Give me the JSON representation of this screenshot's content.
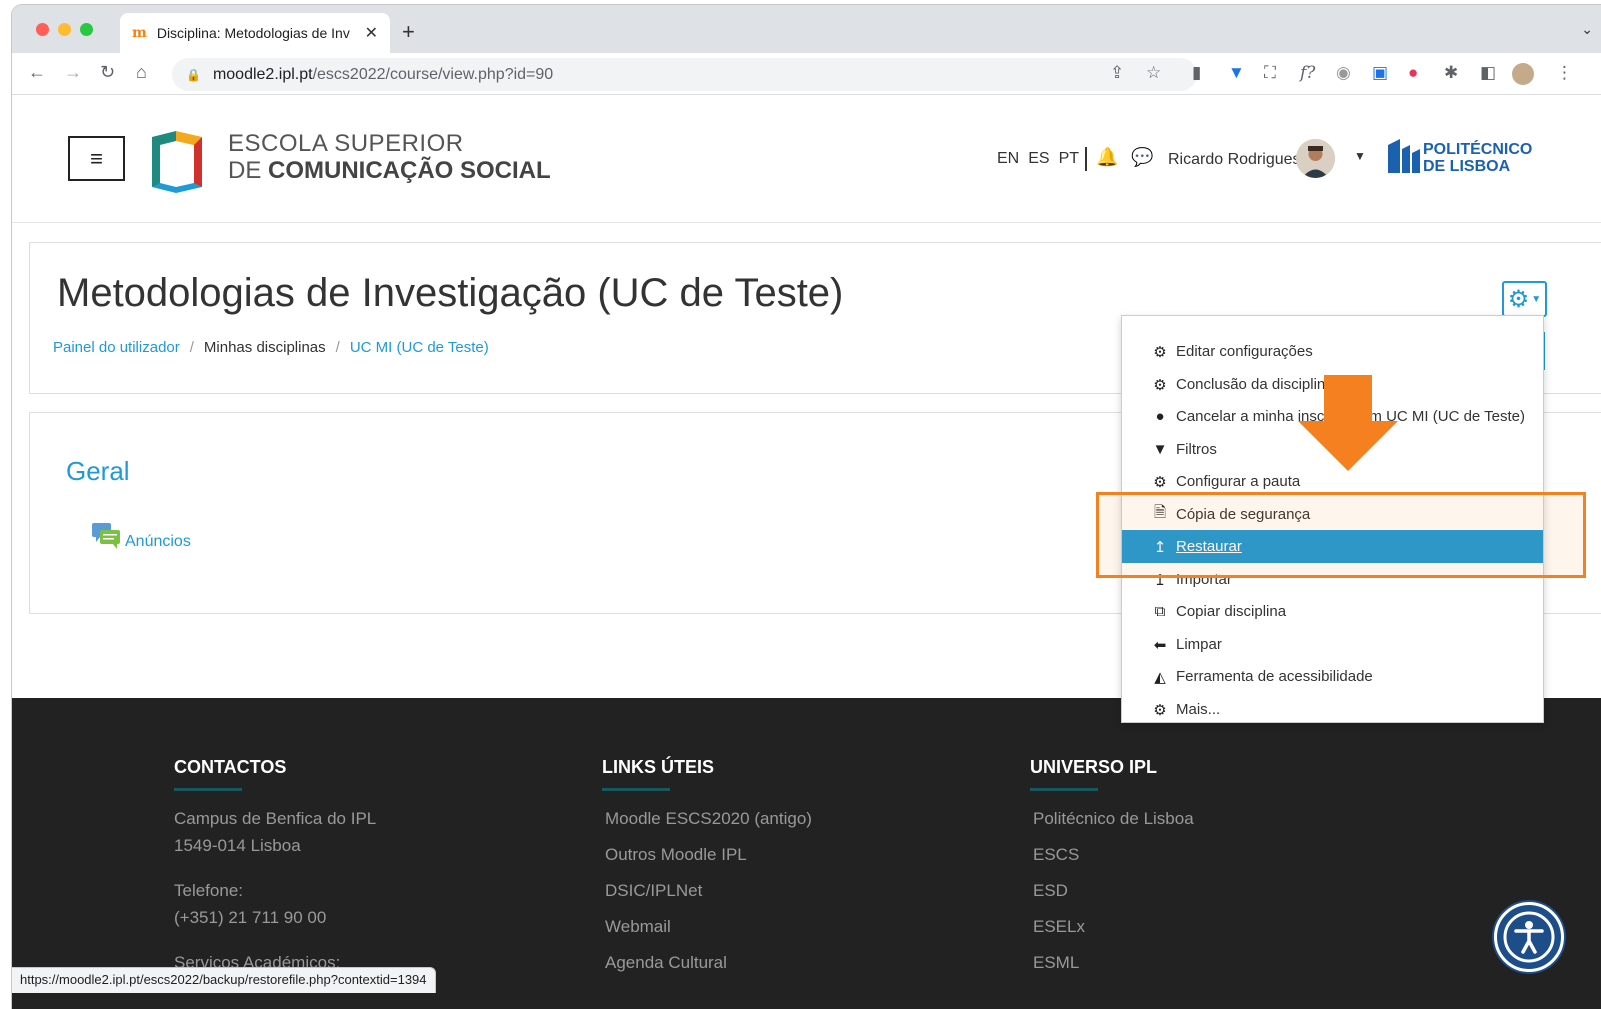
{
  "browser": {
    "tab_title": "Disciplina: Metodologias de Inv",
    "tab_close": "✕",
    "new_tab": "+",
    "url_domain": "moodle2.ipl.pt",
    "url_path": "/escs2022/course/view.php?id=90",
    "status_url": "https://moodle2.ipl.pt/escs2022/backup/restorefile.php?contextid=1394"
  },
  "header": {
    "logo_line1": "ESCOLA SUPERIOR",
    "logo_line2a": "DE ",
    "logo_line2b": "COMUNICAÇÃO SOCIAL",
    "languages": [
      "EN",
      "ES",
      "PT"
    ],
    "user_name": "Ricardo Rodrigues",
    "partner_line1": "POLITÉCNICO",
    "partner_line2": "DE LISBOA"
  },
  "course": {
    "title": "Metodologias de Investigação (UC de Teste)",
    "breadcrumb": [
      "Painel do utilizador",
      "Minhas disciplinas",
      "UC MI (UC de Teste)"
    ],
    "breadcrumb_sep": "/",
    "section_title": "Geral",
    "activity": "Anúncios"
  },
  "menu": {
    "items": [
      {
        "label": "Editar configurações",
        "icon": "gear-icon"
      },
      {
        "label": "Conclusão da disciplina",
        "icon": "gear-icon"
      },
      {
        "label": "Cancelar a minha inscrição em UC MI (UC de Teste)",
        "icon": "user-icon"
      },
      {
        "label": "Filtros",
        "icon": "filter-icon"
      },
      {
        "label": "Configurar a pauta",
        "icon": "gear-icon"
      },
      {
        "label": "Cópia de segurança",
        "icon": "file-icon"
      },
      {
        "label": "Restaurar",
        "icon": "upload-icon"
      },
      {
        "label": "Importar",
        "icon": "upload-icon"
      },
      {
        "label": "Copiar disciplina",
        "icon": "copy-icon"
      },
      {
        "label": "Limpar",
        "icon": "arrow-left-icon"
      },
      {
        "label": "Ferramenta de acessibilidade",
        "icon": "chart-icon"
      },
      {
        "label": "Mais...",
        "icon": "gear-icon"
      }
    ],
    "active_index": 6
  },
  "footer": {
    "contacts_title": "CONTACTOS",
    "contacts": [
      "Campus de Benfica do IPL",
      "1549-014 Lisboa",
      "Telefone:",
      "(+351) 21 711 90 00",
      "Serviços Académicos:"
    ],
    "links_title": "LINKS ÚTEIS",
    "links": [
      "Moodle ESCS2020 (antigo)",
      "Outros Moodle IPL",
      "DSIC/IPLNet",
      "Webmail",
      "Agenda Cultural"
    ],
    "ipl_title": "UNIVERSO IPL",
    "ipl": [
      "Politécnico de Lisboa",
      "ESCS",
      "ESD",
      "ESELx",
      "ESML"
    ]
  },
  "colors": {
    "accent": "#1e9ad6",
    "highlight": "#f5801f",
    "footer_bg": "#222222",
    "brand_blue": "#1a62b0"
  }
}
